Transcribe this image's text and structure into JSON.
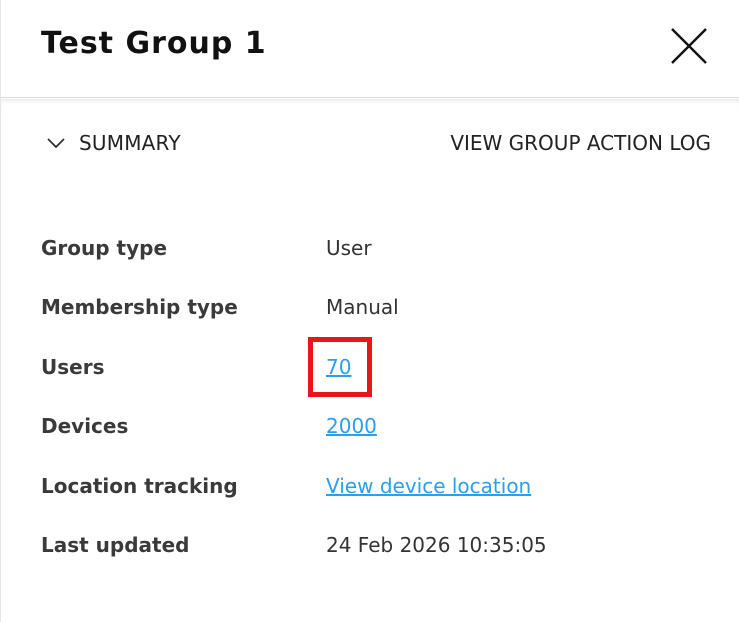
{
  "header": {
    "title": "Test Group 1",
    "close_icon": "close-icon"
  },
  "summary": {
    "toggle_label": "SUMMARY",
    "toggle_icon": "chevron-down-icon",
    "action_log_label": "VIEW GROUP ACTION LOG"
  },
  "details": {
    "group_type": {
      "label": "Group type",
      "value": "User"
    },
    "membership_type": {
      "label": "Membership type",
      "value": "Manual"
    },
    "users": {
      "label": "Users",
      "value": "70"
    },
    "devices": {
      "label": "Devices",
      "value": "2000"
    },
    "location_tracking": {
      "label": "Location tracking",
      "value": "View device location"
    },
    "last_updated": {
      "label": "Last updated",
      "value": "24 Feb 2026 10:35:05"
    }
  },
  "colors": {
    "link": "#2aa0ea",
    "highlight": "#e8151b"
  }
}
